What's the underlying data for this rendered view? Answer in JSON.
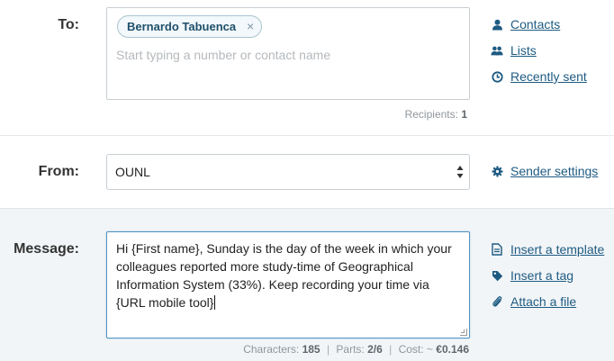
{
  "to": {
    "label": "To:",
    "recipient_chip": "Bernardo Tabuenca",
    "chip_remove": "×",
    "placeholder": "Start typing a number or contact name",
    "recipients_label": "Recipients:",
    "recipients_count": "1"
  },
  "to_links": {
    "contacts": "Contacts",
    "lists": "Lists",
    "recently_sent": "Recently sent"
  },
  "from": {
    "label": "From:",
    "selected_value": "OUNL",
    "sender_settings": "Sender settings"
  },
  "message": {
    "label": "Message:",
    "body": "Hi {First name}, Sunday is the day of the week in which your colleagues reported more study-time of Geographical Information System (33%). Keep recording your time via {URL mobile tool}",
    "line1": "Hi {First name}, Sunday is the day of the week in which your",
    "line2": "colleagues reported more study-time of Geographical",
    "line3": "Information System (33%). Keep recording your time via",
    "line4": "{URL mobile tool}",
    "characters_label": "Characters:",
    "characters_value": "185",
    "parts_label": "Parts:",
    "parts_value": "2/6",
    "cost_label": "Cost: ~",
    "cost_value": "€0.146",
    "separator": "|"
  },
  "message_links": {
    "insert_template": "Insert a template",
    "insert_tag": "Insert a tag",
    "attach_file": "Attach a file"
  },
  "colors": {
    "link": "#1e5b82",
    "focus_border": "#4f93c0",
    "message_bg": "#f2f5f7"
  },
  "icons": {
    "contacts": "user-icon",
    "lists": "users-icon",
    "recently_sent": "clock-icon",
    "sender_settings": "gear-icon",
    "insert_template": "document-icon",
    "insert_tag": "tag-icon",
    "attach_file": "paperclip-icon"
  }
}
